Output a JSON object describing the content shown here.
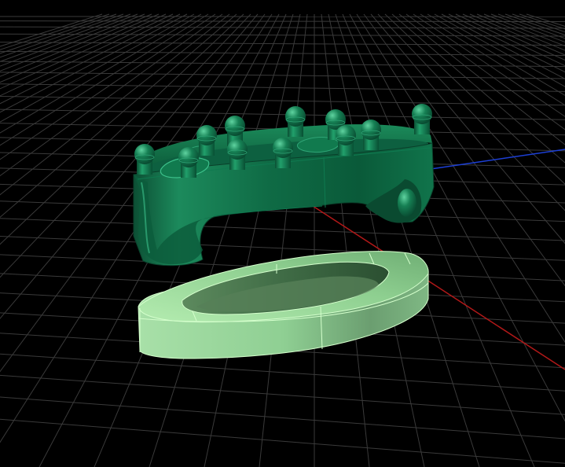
{
  "viewport": {
    "background": "#000000",
    "grid_color": "#3a3a3a",
    "axis_x_color": "#b01818",
    "axis_y_color": "#1c3fd6",
    "axis_z_color": "#18a83a"
  },
  "scene": {
    "objects": [
      {
        "name": "upper-part",
        "state": "unselected",
        "color": "#0f6b45",
        "pin_count": 11
      },
      {
        "name": "lower-ring",
        "state": "selected",
        "color": "#9fdca4",
        "edge_color": "#c8f7c0"
      }
    ]
  }
}
